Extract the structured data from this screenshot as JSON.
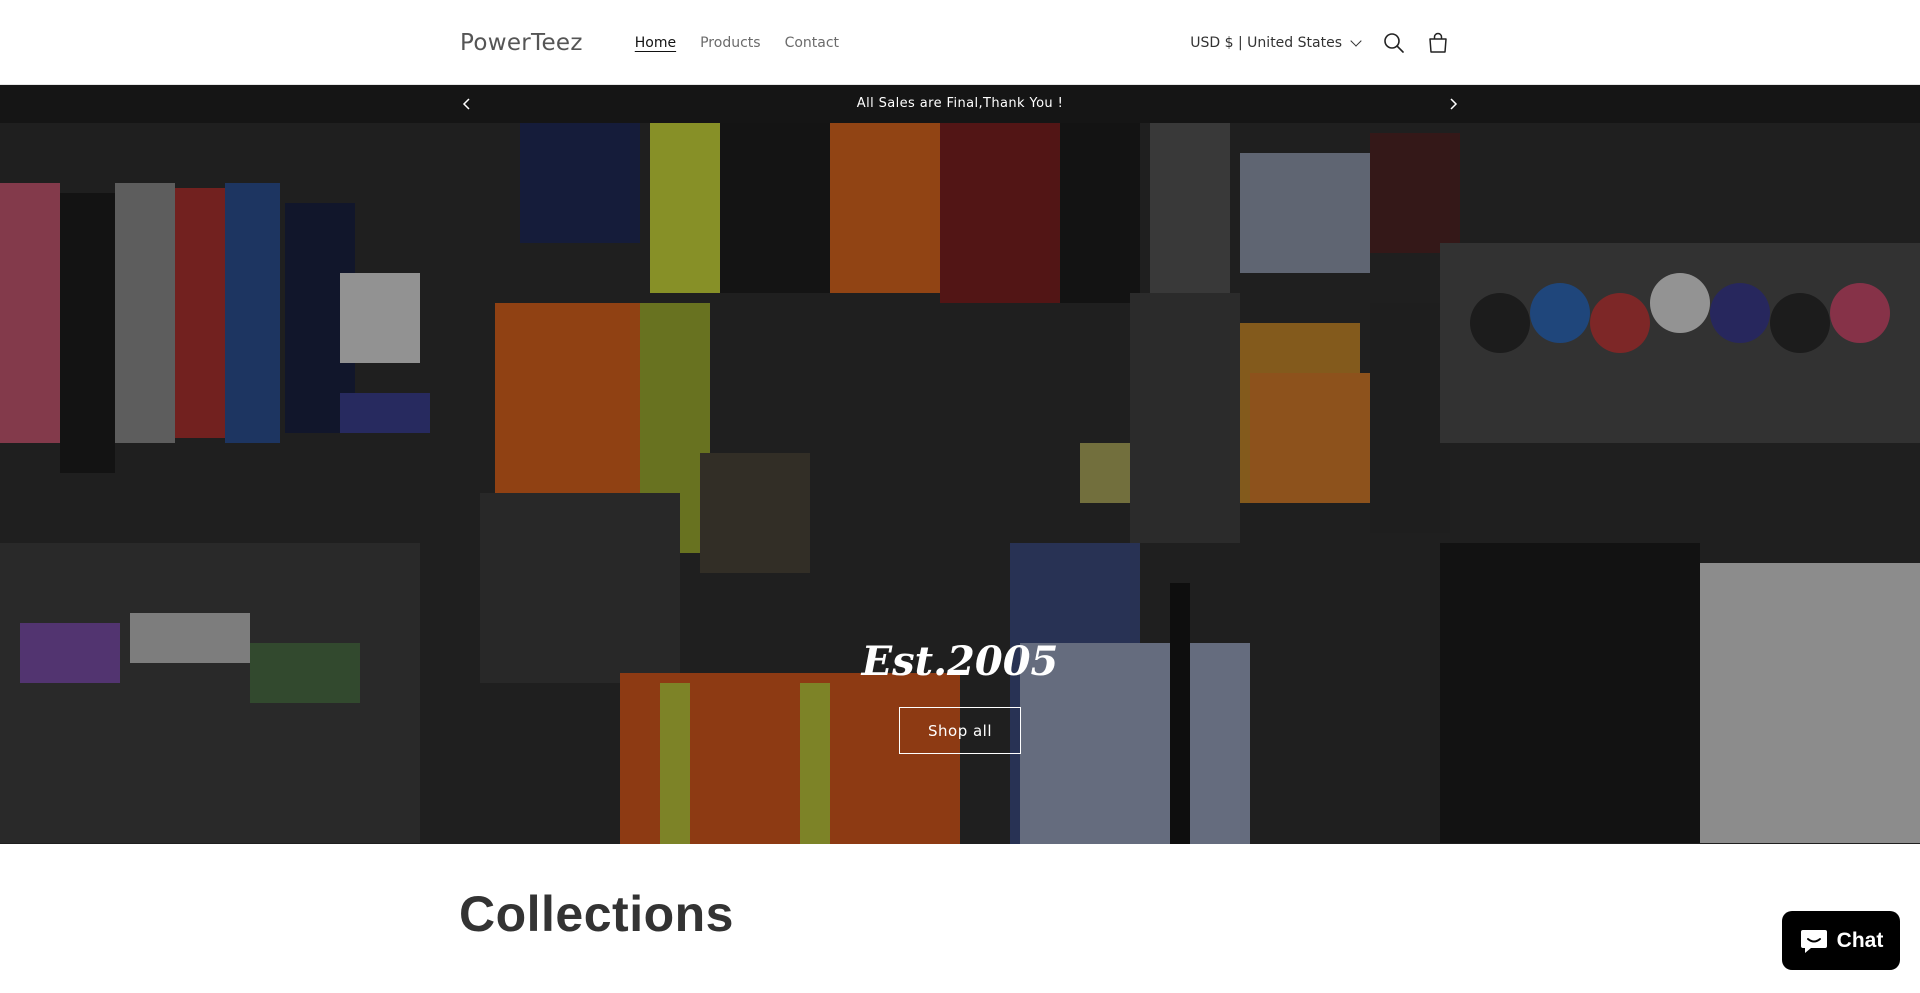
{
  "header": {
    "logo": "PowerTeez",
    "nav": [
      {
        "label": "Home",
        "active": true
      },
      {
        "label": "Products",
        "active": false
      },
      {
        "label": "Contact",
        "active": false
      }
    ],
    "currency": "USD $ | United States",
    "icons": {
      "search": "search-icon",
      "cart": "cart-icon",
      "currency_dropdown": "chevron-down-icon"
    }
  },
  "announcement": {
    "text": "All Sales are Final,Thank You !",
    "prev_icon": "chevron-left-icon",
    "next_icon": "chevron-right-icon"
  },
  "hero": {
    "title": "Est.2005",
    "button_label": "Shop all"
  },
  "collections": {
    "heading": "Collections"
  },
  "chat": {
    "label": "Chat",
    "icon": "chat-bubble-icon"
  },
  "colors": {
    "announcement_bg": "#151515",
    "chat_bg": "#000000",
    "text": "#121212"
  }
}
